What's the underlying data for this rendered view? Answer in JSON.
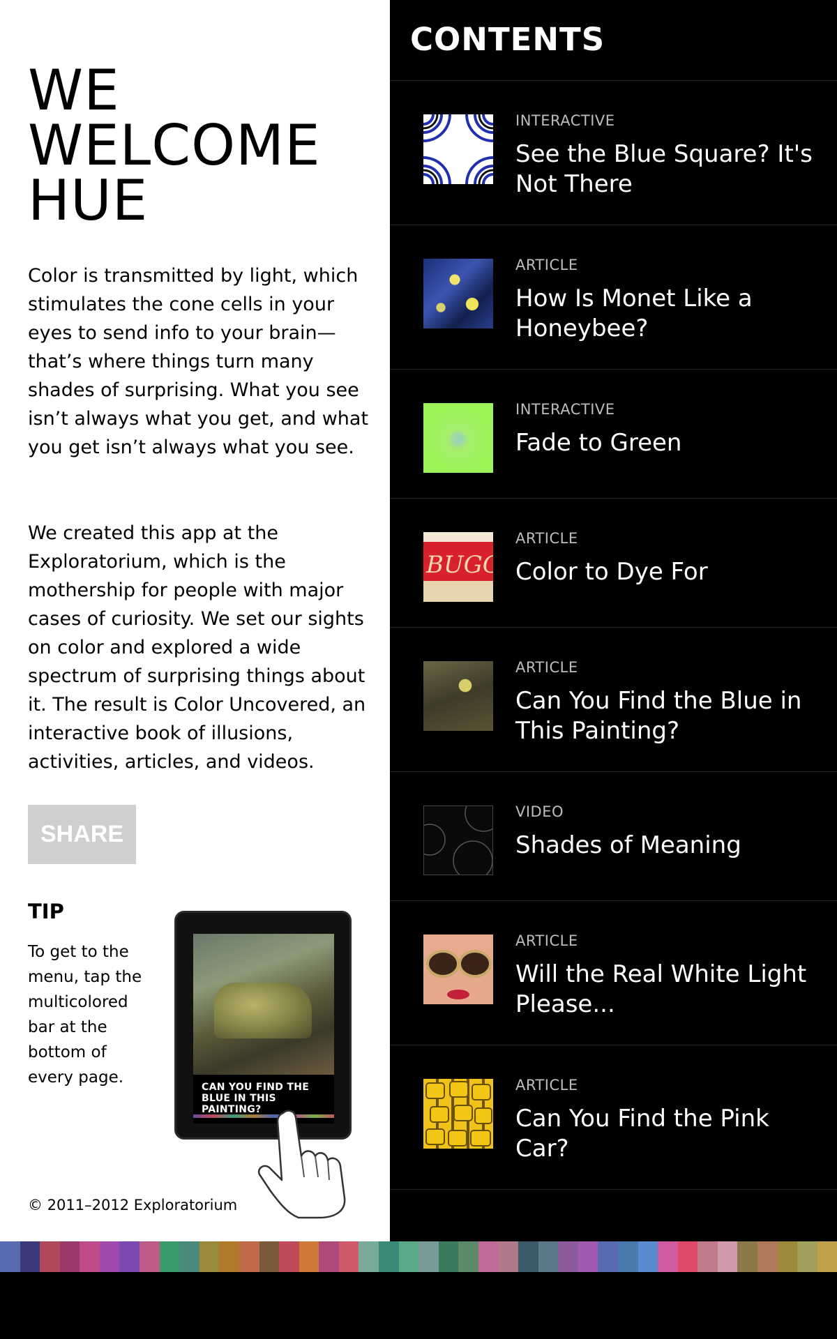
{
  "intro": {
    "title": "WE\nWELCOME\nHUE",
    "paragraph1": "Color is transmitted by light, which stimulates the cone cells in your eyes to send info to your brain—that’s where things turn many shades of surprising. What you see isn’t always what you get, and what you get isn’t always what you see.",
    "paragraph2": "We created this app at the Exploratorium, which is the mothership for people with major cases of curiosity. We set our sights on color and explored a wide spectrum of surprising things about it. The result is Color Uncovered, an interactive book of illusions, activities, articles, and videos.",
    "share_label": "SHARE",
    "tip_title": "TIP",
    "tip_text": "To get to the menu, tap the multicolored bar at the bottom of every page.",
    "tablet_caption": "CAN YOU FIND THE BLUE IN THIS PAINTING?",
    "copyright": "© 2011–2012 Exploratorium"
  },
  "contents": {
    "title": "CONTENTS",
    "items": [
      {
        "type": "INTERACTIVE",
        "title": "See the Blue Square? It's Not There",
        "thumb": "concentric-circles-illusion"
      },
      {
        "type": "ARTICLE",
        "title": "How Is Monet Like a Honeybee?",
        "thumb": "water-lilies-painting"
      },
      {
        "type": "INTERACTIVE",
        "title": "Fade to Green",
        "thumb": "green-square"
      },
      {
        "type": "ARTICLE",
        "title": "Color to Dye For",
        "thumb": "red-yogurt-label"
      },
      {
        "type": "ARTICLE",
        "title": "Can You Find the Blue in This Painting?",
        "thumb": "rusty-truck-painting"
      },
      {
        "type": "VIDEO",
        "title": "Shades of Meaning",
        "thumb": "dark-circles-text"
      },
      {
        "type": "ARTICLE",
        "title": "Will the Real White Light Please...",
        "thumb": "woman-sunglasses"
      },
      {
        "type": "ARTICLE",
        "title": "Can You Find the Pink Car?",
        "thumb": "yellow-taxis"
      }
    ]
  },
  "color_bar": {
    "colors": [
      "#5a6ab0",
      "#3a3a7a",
      "#b04a5a",
      "#9a3a6a",
      "#c04a8a",
      "#a04ab0",
      "#7a4ab0",
      "#c05a8a",
      "#3a9a6a",
      "#4a8a7a",
      "#9a8a3a",
      "#b07a2a",
      "#c06a4a",
      "#7a5a3a",
      "#c04a5a",
      "#d07a3a",
      "#b04a7a",
      "#d05a6a",
      "#7aaa9a",
      "#3a8a7a",
      "#5aaa8a",
      "#7a9a9a",
      "#3a7a5a",
      "#5a8a6a",
      "#c06a9a",
      "#b07a8a",
      "#3a5a6a",
      "#5a7a8a",
      "#8a5a9a",
      "#a05ab0",
      "#5a6ab0",
      "#4a7ab0",
      "#5a8ad0",
      "#d05aa0",
      "#e04a6a",
      "#c07a8a",
      "#d09aaa",
      "#8a7a4a",
      "#b07a5a",
      "#9a8a3a",
      "#a0a05a",
      "#c0a04a"
    ]
  }
}
